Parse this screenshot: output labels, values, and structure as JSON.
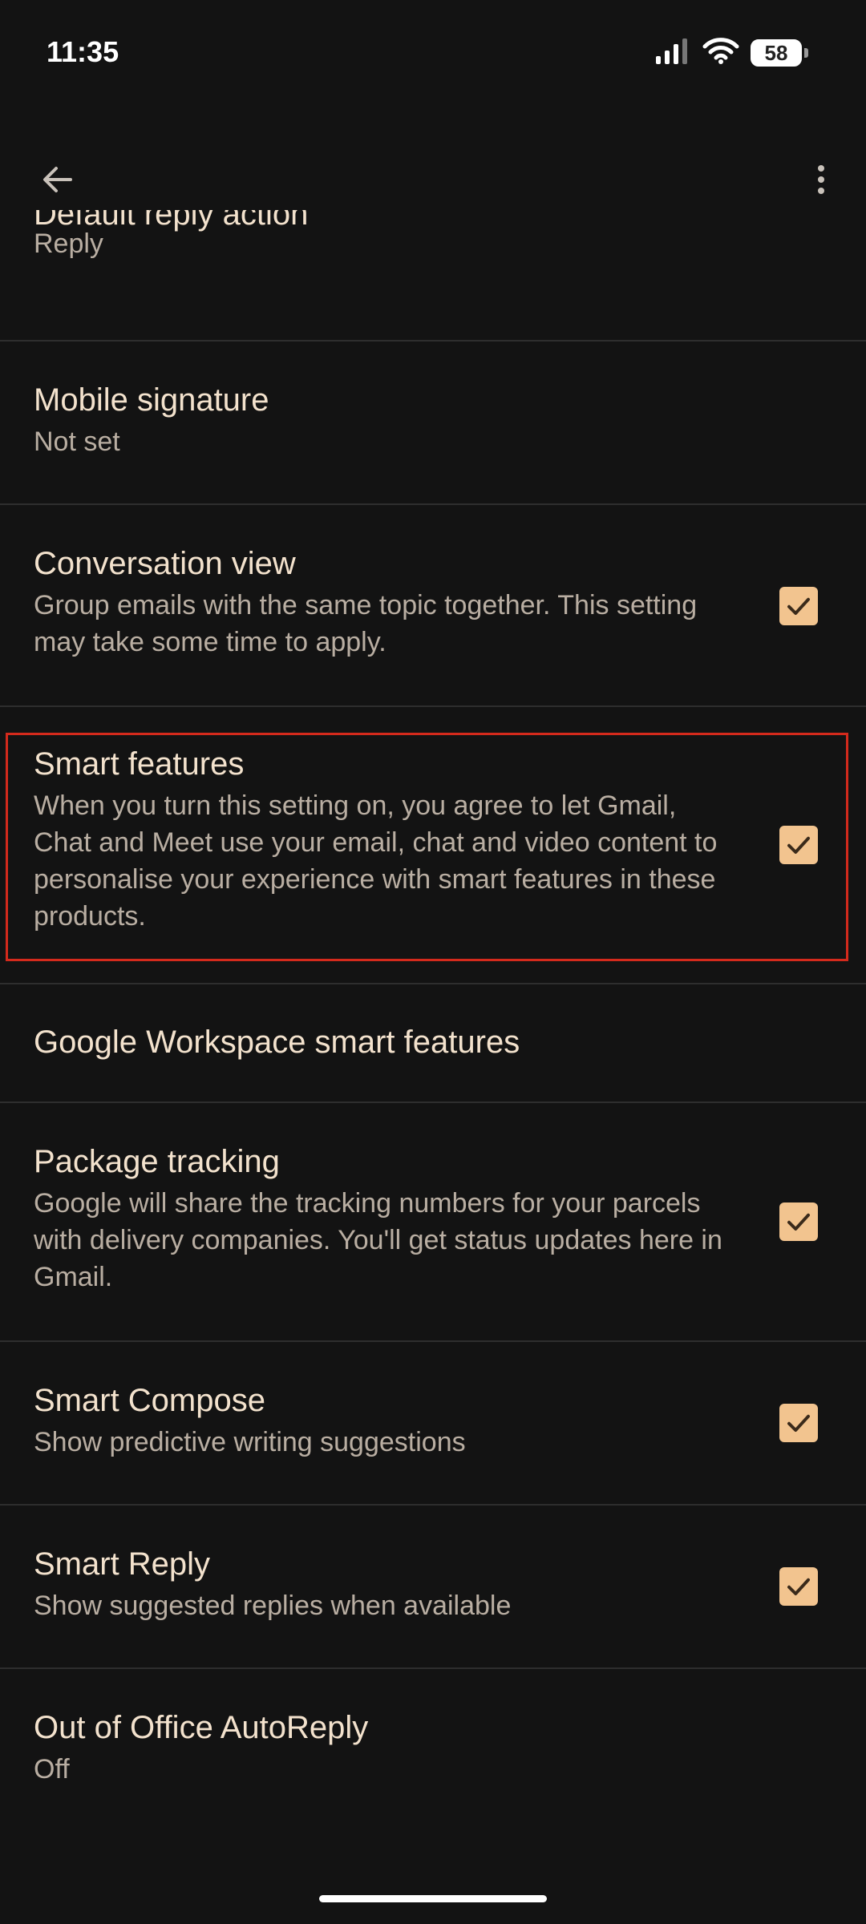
{
  "status_bar": {
    "time": "11:35",
    "battery": "58"
  },
  "settings": [
    {
      "title": "Default reply action",
      "subtitle": "Reply"
    },
    {
      "title": "Mobile signature",
      "subtitle": "Not set"
    },
    {
      "title": "Conversation view",
      "subtitle": "Group emails with the same topic together. This setting may take some time to apply.",
      "checked": true
    },
    {
      "title": "Smart features",
      "subtitle": "When you turn this setting on, you agree to let Gmail, Chat and Meet use your email, chat and video content to personalise your experience with smart features in these products.",
      "checked": true
    },
    {
      "title": "Google Workspace smart features"
    },
    {
      "title": "Package tracking",
      "subtitle": "Google will share the tracking numbers for your parcels with delivery companies. You'll get status updates here in Gmail.",
      "checked": true
    },
    {
      "title": "Smart Compose",
      "subtitle": "Show predictive writing suggestions",
      "checked": true
    },
    {
      "title": "Smart Reply",
      "subtitle": "Show suggested replies when available",
      "checked": true
    },
    {
      "title": "Out of Office AutoReply",
      "subtitle": "Off"
    }
  ],
  "colors": {
    "background": "#131313",
    "checkbox": "#f2c48f",
    "highlight": "#d42a1c"
  },
  "icons": {
    "back": "arrow-back-icon",
    "more": "more-vert-icon",
    "check": "check-icon"
  }
}
